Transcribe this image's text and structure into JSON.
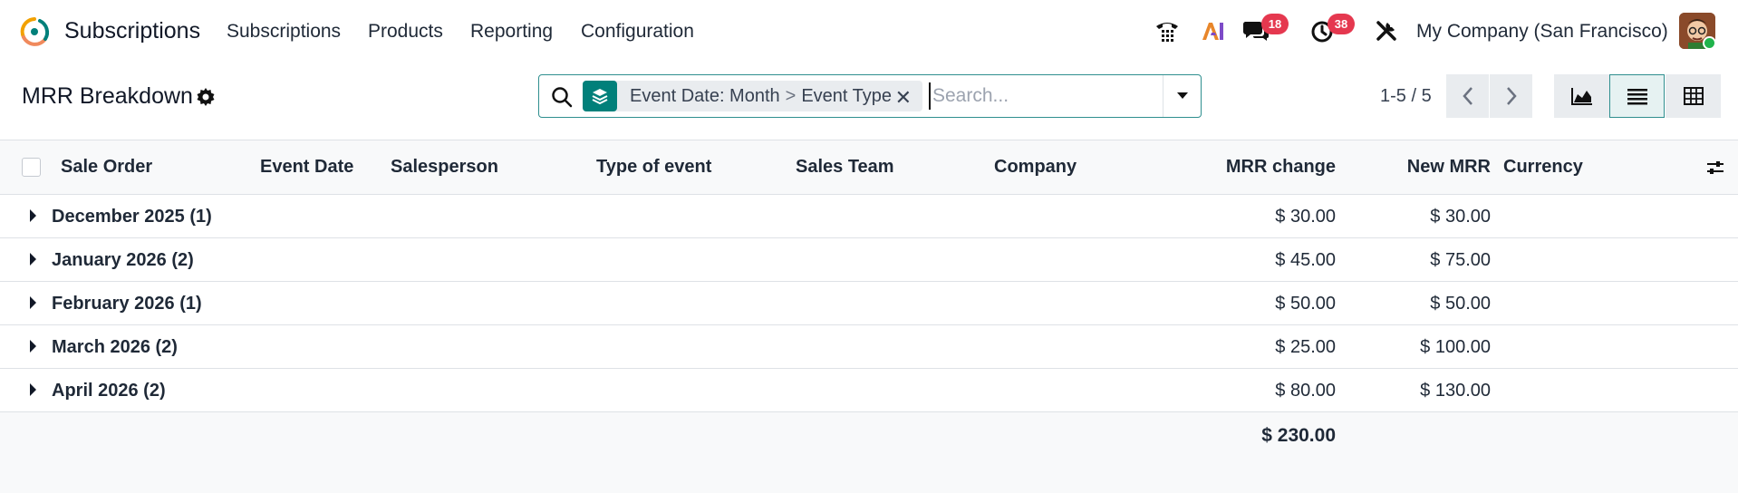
{
  "navbar": {
    "app_name": "Subscriptions",
    "menu": [
      "Subscriptions",
      "Products",
      "Reporting",
      "Configuration"
    ],
    "chat_badge": "18",
    "activity_badge": "38",
    "company": "My Company (San Francisco)",
    "icons": [
      "phone-icon",
      "ai-icon",
      "chat-icon",
      "activity-clock-icon",
      "tools-icon"
    ]
  },
  "control": {
    "title": "MRR Breakdown",
    "facet": {
      "first": "Event Date: Month",
      "separator": ">",
      "second": "Event Type"
    },
    "search_placeholder": "Search...",
    "pager": "1-5 / 5",
    "views": [
      "graph-view",
      "list-view",
      "pivot-view"
    ],
    "active_view": "list-view"
  },
  "table": {
    "columns": {
      "sale_order": "Sale Order",
      "event_date": "Event Date",
      "salesperson": "Salesperson",
      "type_of_event": "Type of event",
      "sales_team": "Sales Team",
      "company": "Company",
      "mrr_change": "MRR change",
      "new_mrr": "New MRR",
      "currency": "Currency"
    },
    "groups": [
      {
        "label": "December 2025 (1)",
        "mrr_change": "$ 30.00",
        "new_mrr": "$ 30.00"
      },
      {
        "label": "January 2026 (2)",
        "mrr_change": "$ 45.00",
        "new_mrr": "$ 75.00"
      },
      {
        "label": "February 2026 (1)",
        "mrr_change": "$ 50.00",
        "new_mrr": "$ 50.00"
      },
      {
        "label": "March 2026 (2)",
        "mrr_change": "$ 25.00",
        "new_mrr": "$ 100.00"
      },
      {
        "label": "April 2026 (2)",
        "mrr_change": "$ 80.00",
        "new_mrr": "$ 130.00"
      }
    ],
    "total_mrr_change": "$ 230.00"
  },
  "colors": {
    "accent": "#01807a",
    "badge": "#e5384f"
  }
}
